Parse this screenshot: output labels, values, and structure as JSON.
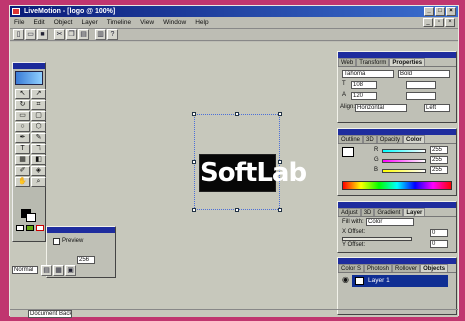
{
  "window": {
    "title": "LiveMotion - [logo @ 100%]"
  },
  "menu": [
    "File",
    "Edit",
    "Object",
    "Layer",
    "Timeline",
    "View",
    "Window",
    "Help"
  ],
  "canvas": {
    "logo_text": "SoftLab"
  },
  "properties_panel": {
    "tabs": [
      "Web",
      "Transform",
      "Properties"
    ],
    "font": "Tahoma",
    "style": "Bold",
    "size": "108",
    "leading": "120",
    "align_label": "Align:",
    "align": "Horizontal",
    "justify": "Left"
  },
  "color_panel": {
    "tabs": [
      "Outline",
      "3D",
      "Opacity",
      "Color"
    ],
    "values": [
      "255",
      "255",
      "255"
    ],
    "channels": [
      "R",
      "G",
      "B"
    ]
  },
  "layer_panel": {
    "tabs": [
      "Adjust",
      "3D",
      "Gradient",
      "Layer"
    ],
    "fill_label": "Fill with:",
    "fill_value": "Color",
    "offset_label": "X Offset:",
    "offset_value": "0",
    "yoffset_label": "Y Offset:",
    "yoffset_value": "0"
  },
  "objects_panel": {
    "tabs": [
      "Color S",
      "Photosh",
      "Rollover",
      "Objects"
    ],
    "layer_name": "Layer 1"
  },
  "preview_panel": {
    "checkbox_label": "Preview",
    "field_value": "256",
    "dropdown_value": "Normal"
  },
  "status": {
    "text": "Document Back"
  },
  "colors": {
    "accent": "#1e2c9e",
    "background": "#c0366f"
  }
}
